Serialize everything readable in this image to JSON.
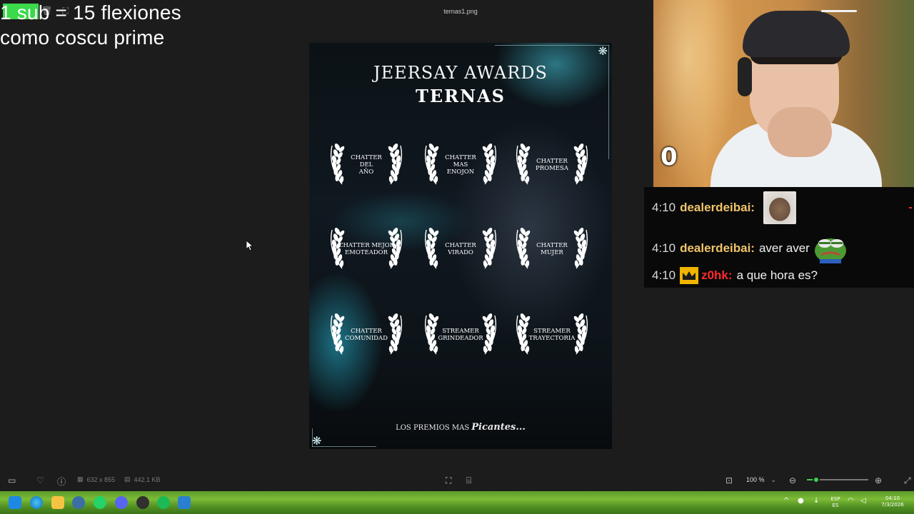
{
  "viewer": {
    "file_name": "ternas1.png",
    "dimensions": "632 x 855",
    "file_size": "442.1 KB",
    "zoom": "100 %",
    "zoom_level": 0.15
  },
  "overlay": {
    "line1": "1 sub = 15 flexiones",
    "line2": "como coscu prime",
    "accent_color": "#3bd94b"
  },
  "poster": {
    "title": "JEERSAY AWARDS",
    "subtitle": "TERNAS",
    "categories": [
      "CHATTER\nDEL\nAÑO",
      "CHATTER\nMAS\nENOJON",
      "CHATTER\nPROMESA",
      "CHATTER MEJOR\nEMOTEADOR",
      "CHATTER\nVIRADO",
      "CHATTER\nMUJER",
      "CHATTER\nCOMUNIDAD",
      "STREAMER\nGRINDEADOR",
      "STREAMER\nTRAYECTORIA"
    ],
    "footer_text": "LOS PREMIOS MAS",
    "footer_accent": "Picantes..."
  },
  "webcam": {
    "counter": "0"
  },
  "chat": {
    "messages": [
      {
        "time": "4:10",
        "user": "dealerdeibai:",
        "user_color": "#f0c46a",
        "text": "",
        "emote": "hamster-emote"
      },
      {
        "time": "4:10",
        "user": "dealerdeibai:",
        "user_color": "#f0c46a",
        "text": "aver aver",
        "emote": "pepe-emote"
      },
      {
        "time": "4:10",
        "user": "z0hk:",
        "user_color": "#ff2b2b",
        "text": "a que hora es?",
        "badge": "crown-badge"
      }
    ]
  },
  "taskbar": {
    "language_top": "ESP",
    "language_bottom": "ES",
    "clock_time": "04:10",
    "clock_date": "7/3/2026",
    "apps": [
      "start-icon",
      "edge-icon",
      "file-explorer-icon",
      "chrome-icon",
      "whatsapp-icon",
      "discord-icon",
      "obs-icon",
      "spotify-icon",
      "photos-icon"
    ]
  }
}
